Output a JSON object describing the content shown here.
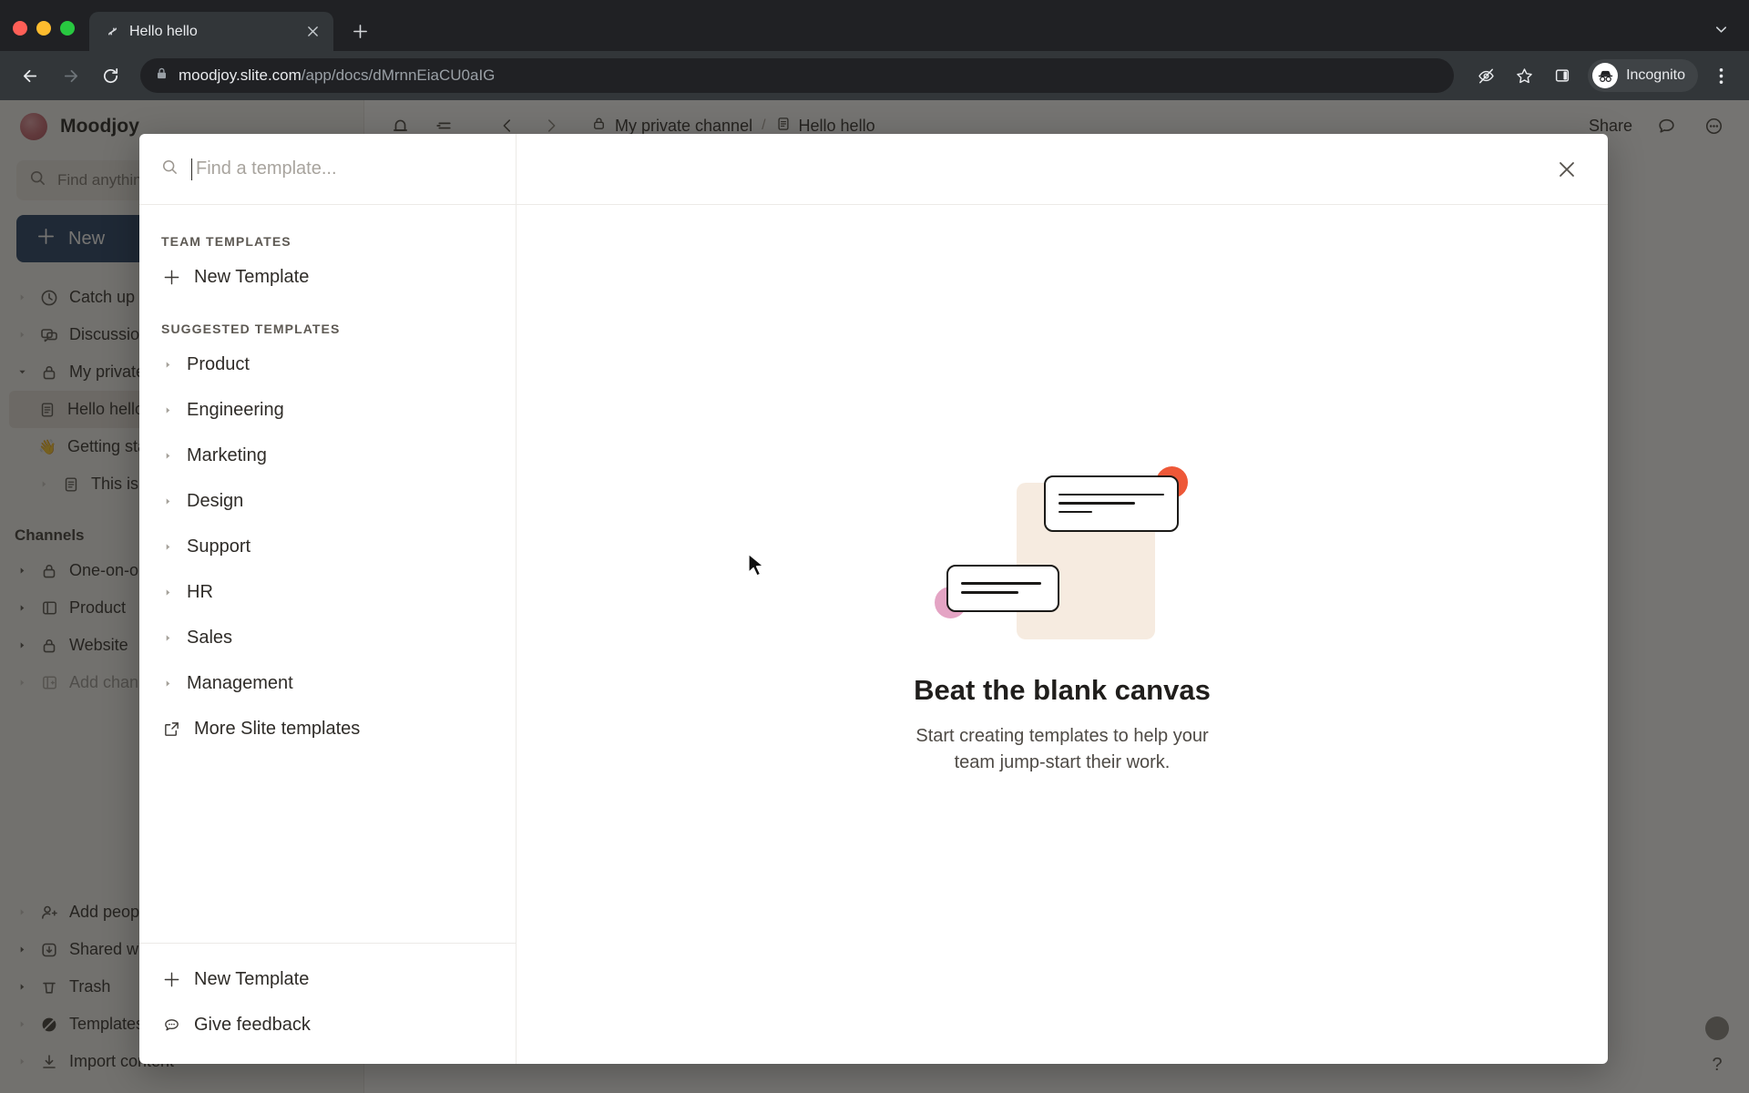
{
  "browser": {
    "tab": {
      "title": "Hello hello",
      "favicon": "slite-favicon",
      "close_label": "×"
    },
    "new_tab_label": "+",
    "tabstrip_caret": "chevron-down-icon",
    "omnibox": {
      "host": "moodjoy.slite.com",
      "path": "/app/docs/dMrnnEiaCU0aIG",
      "lock": "lock-icon"
    },
    "toolbar_icons": [
      "eye-off-icon",
      "star-icon",
      "side-panel-icon"
    ],
    "profile": {
      "label": "Incognito",
      "icon": "incognito-icon"
    },
    "menu": "kebab-menu-icon"
  },
  "app": {
    "workspace": {
      "name": "Moodjoy"
    },
    "search": {
      "placeholder": "Find anything..."
    },
    "new_button": {
      "label": "New",
      "icon": "plus-icon"
    },
    "nav_items": [
      {
        "label": "Catch up",
        "icon": "clock-icon",
        "indent": 0,
        "twisty": "faint"
      },
      {
        "label": "Discussions",
        "icon": "discussions-icon",
        "indent": 0,
        "twisty": "faint"
      },
      {
        "label": "My private channel",
        "icon": "lock-icon",
        "indent": 0,
        "twisty": "down"
      },
      {
        "label": "Hello hello",
        "icon": "doc-icon",
        "indent": 1,
        "twisty": "none",
        "active": true
      },
      {
        "label": "Getting started",
        "icon": "wave-emoji",
        "indent": 1,
        "twisty": "none"
      },
      {
        "label": "This is a doc",
        "icon": "doc-icon",
        "indent": 1,
        "twisty": "right"
      }
    ],
    "channels_title": "Channels",
    "channels": [
      {
        "label": "One-on-one",
        "icon": "lock-icon"
      },
      {
        "label": "Product",
        "icon": "channel-icon"
      },
      {
        "label": "Website",
        "icon": "lock-icon"
      },
      {
        "label": "Add channel",
        "icon": "add-channel-icon",
        "dim": true
      }
    ],
    "bottom_items": [
      {
        "label": "Add people",
        "icon": "add-person-icon"
      },
      {
        "label": "Shared with me",
        "icon": "shared-icon"
      },
      {
        "label": "Trash",
        "icon": "trash-icon"
      },
      {
        "label": "Templates",
        "icon": "templates-icon"
      },
      {
        "label": "Import content",
        "icon": "import-icon"
      }
    ],
    "topbar": {
      "icons": [
        "bell-icon",
        "collapse-sidebar-icon",
        "back-icon",
        "forward-icon"
      ],
      "breadcrumb": [
        {
          "label": "My private channel",
          "icon": "lock-icon"
        },
        {
          "label": "Hello hello",
          "icon": "doc-icon"
        }
      ],
      "separator": "/",
      "share_label": "Share",
      "right_icons": [
        "comment-icon",
        "more-icon"
      ]
    },
    "fab": {
      "bubble": "chat-bubble-icon",
      "help": "?"
    }
  },
  "modal": {
    "search": {
      "placeholder": "Find a template...",
      "value": "",
      "icon": "search-icon"
    },
    "close_icon": "close-icon",
    "team_templates_title": "TEAM TEMPLATES",
    "new_template_top": {
      "label": "New Template",
      "icon": "plus-icon"
    },
    "suggested_title": "SUGGESTED TEMPLATES",
    "suggested": [
      {
        "label": "Product"
      },
      {
        "label": "Engineering"
      },
      {
        "label": "Marketing"
      },
      {
        "label": "Design"
      },
      {
        "label": "Support"
      },
      {
        "label": "HR"
      },
      {
        "label": "Sales"
      },
      {
        "label": "Management"
      }
    ],
    "more_templates": {
      "label": "More Slite templates",
      "icon": "external-link-icon"
    },
    "footer": [
      {
        "label": "New Template",
        "icon": "plus-icon"
      },
      {
        "label": "Give feedback",
        "icon": "feedback-icon"
      }
    ],
    "empty_state": {
      "title": "Beat the blank canvas",
      "subtitle": "Start creating templates to help your team jump-start their work.",
      "illustration": "documents-illustration",
      "colors": {
        "orange": "#ee5838",
        "pink": "#e4a4c4",
        "beige": "#f6ebe0"
      }
    }
  }
}
